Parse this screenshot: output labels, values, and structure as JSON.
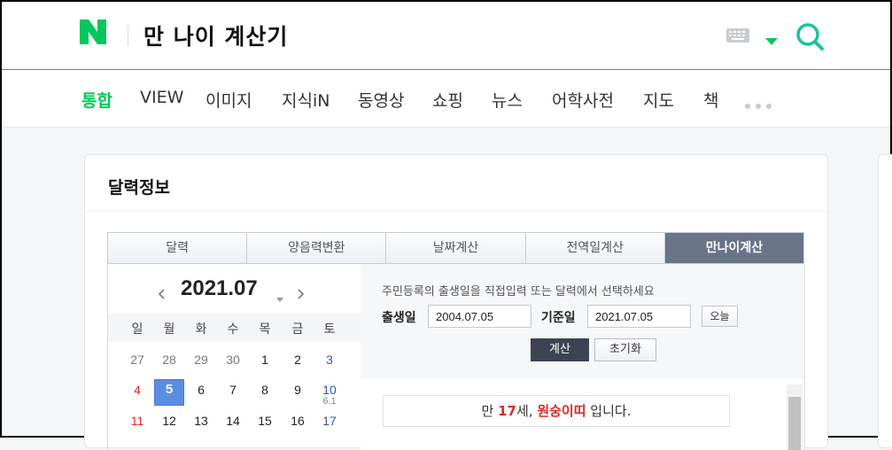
{
  "header": {
    "query": "만 나이 계산기",
    "brand_color": "#03c75a"
  },
  "nav": {
    "items": [
      "통합",
      "VIEW",
      "이미지",
      "지식iN",
      "동영상",
      "쇼핑",
      "뉴스",
      "어학사전",
      "지도",
      "책"
    ],
    "active_index": 0,
    "more_icon": "more-dots-icon"
  },
  "card": {
    "title": "달력정보",
    "tabs": [
      "달력",
      "양음력변환",
      "날짜계산",
      "전역일계산",
      "만나이계산"
    ],
    "active_tab": 4
  },
  "calendar": {
    "month_label": "2021.07",
    "weekdays": [
      "일",
      "월",
      "화",
      "수",
      "목",
      "금",
      "토"
    ],
    "rows": [
      [
        "27",
        "28",
        "29",
        "30",
        "1",
        "2",
        "3"
      ],
      [
        "4",
        "5",
        "6",
        "7",
        "8",
        "9",
        "10"
      ],
      [
        "11",
        "12",
        "13",
        "14",
        "15",
        "16",
        "17"
      ]
    ],
    "selected_day": "5",
    "lunar_note": "6.1"
  },
  "calc": {
    "hint": "주민등록의 출생일을 직접입력 또는 달력에서 선택하세요",
    "birth_label": "출생일",
    "birth_value": "2004.07.05",
    "ref_label": "기준일",
    "ref_value": "2021.07.05",
    "today_button": "오늘",
    "calc_button": "계산",
    "reset_button": "초기화"
  },
  "result": {
    "prefix": "만 ",
    "age": "17",
    "unit": "세, ",
    "zodiac": "원숭이띠",
    "suffix": " 입니다."
  }
}
